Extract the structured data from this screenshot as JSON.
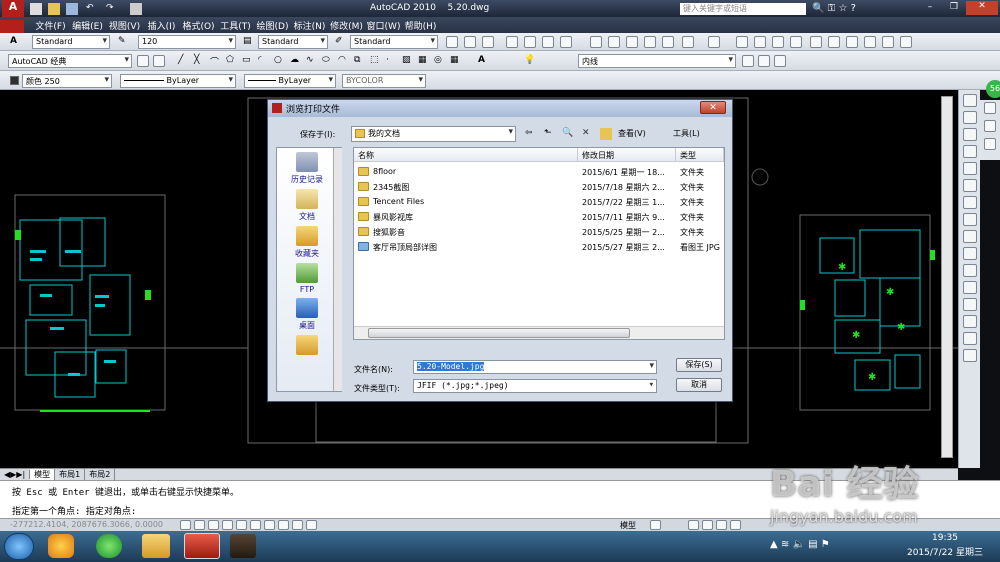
{
  "titlebar": {
    "app": "AutoCAD 2010",
    "file": "5.20.dwg",
    "search_placeholder": "键入关键字或短语"
  },
  "menu": [
    "文件(F)",
    "编辑(E)",
    "视图(V)",
    "插入(I)",
    "格式(O)",
    "工具(T)",
    "绘图(D)",
    "标注(N)",
    "修改(M)",
    "窗口(W)",
    "帮助(H)"
  ],
  "toolbar1": {
    "textstyle": "Standard",
    "dimsize": "120",
    "dimstyle": "Standard",
    "tablestyle": "Standard"
  },
  "toolbar2": {
    "workspace": "AutoCAD 经典",
    "linetype_right": "内线"
  },
  "toolbar3": {
    "color": "颜色 250",
    "linetype": "ByLayer",
    "lineweight": "ByLayer",
    "plotstyle": "BYCOLOR"
  },
  "dialog": {
    "title": "浏览打印文件",
    "save_in_label": "保存于(I):",
    "save_in_value": "我的文档",
    "view_label": "查看(V)",
    "tools_label": "工具(L)",
    "places": [
      "历史记录",
      "文档",
      "收藏夹",
      "FTP",
      "桌面"
    ],
    "columns": [
      "名称",
      "修改日期",
      "类型"
    ],
    "files": [
      {
        "name": "8floor",
        "date": "2015/6/1 星期一 18...",
        "type": "文件夹"
      },
      {
        "name": "2345截图",
        "date": "2015/7/18 星期六 2...",
        "type": "文件夹"
      },
      {
        "name": "Tencent Files",
        "date": "2015/7/22 星期三 1...",
        "type": "文件夹"
      },
      {
        "name": "暴风影视库",
        "date": "2015/7/11 星期六 9...",
        "type": "文件夹"
      },
      {
        "name": "搜狐影音",
        "date": "2015/5/25 星期一 2...",
        "type": "文件夹"
      },
      {
        "name": "客厅吊顶局部详图",
        "date": "2015/5/27 星期三 2...",
        "type": "看图王 JPG"
      }
    ],
    "filename_label": "文件名(N):",
    "filename_value": "5.20-Model.jpg",
    "filetype_label": "文件类型(T):",
    "filetype_value": "JFIF (*.jpg;*.jpeg)",
    "save_button": "保存(S)",
    "cancel_button": "取消"
  },
  "layout_tabs": [
    "模型",
    "布局1",
    "布局2"
  ],
  "command": {
    "line1": "按 Esc 或 Enter 键退出，或单击右键显示快捷菜单。",
    "line2": "指定第一个角点: 指定对角点:"
  },
  "status": {
    "coords": "-277212.4104, 2087676.3066, 0.0000",
    "model": "模型"
  },
  "taskbar": {
    "time": "19:35",
    "date": "2015/7/22 星期三"
  },
  "watermark": {
    "logo": "Bai 经验",
    "url": "jingyan.baidu.com"
  },
  "badge": "56"
}
